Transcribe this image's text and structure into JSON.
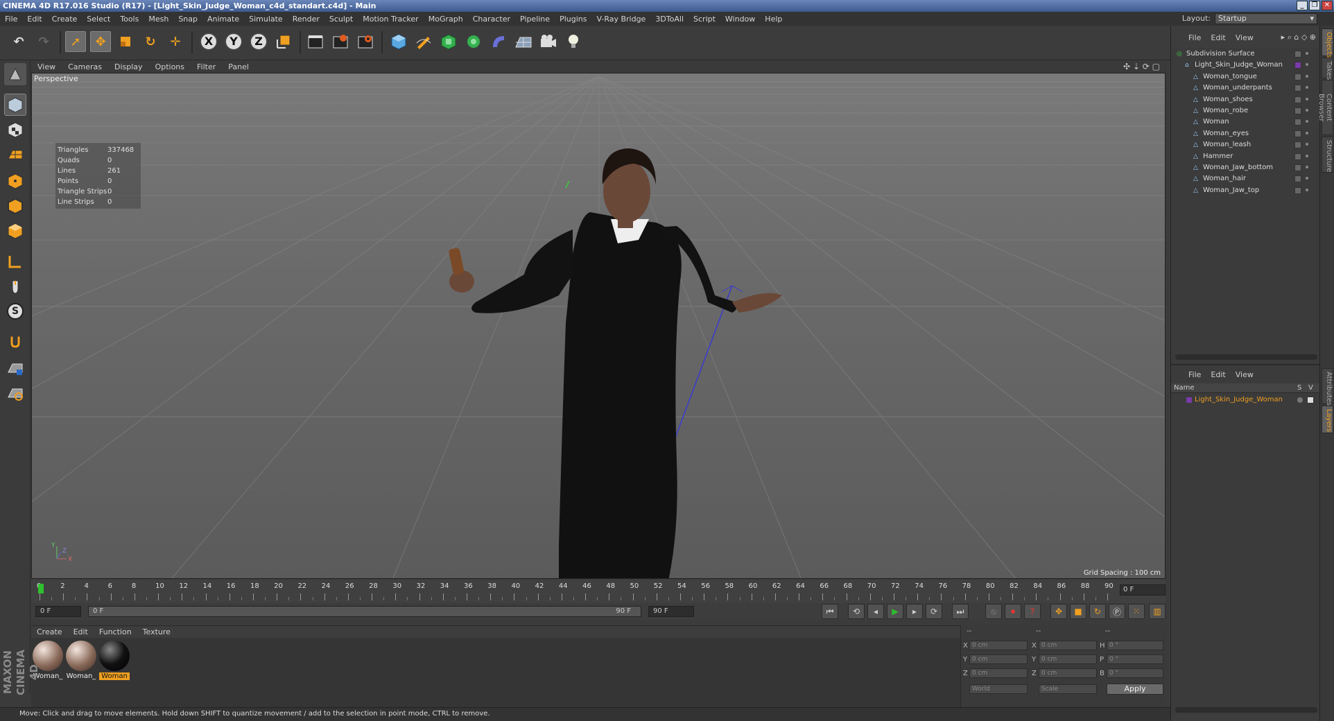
{
  "window": {
    "title": "CINEMA 4D R17.016 Studio (R17) - [Light_Skin_Judge_Woman_c4d_standart.c4d] - Main",
    "controls": [
      "_",
      "❐",
      "✕"
    ]
  },
  "menubar": {
    "items": [
      "File",
      "Edit",
      "Create",
      "Select",
      "Tools",
      "Mesh",
      "Snap",
      "Animate",
      "Simulate",
      "Render",
      "Sculpt",
      "Motion Tracker",
      "MoGraph",
      "Character",
      "Pipeline",
      "Plugins",
      "V-Ray Bridge",
      "3DToAll",
      "Script",
      "Window",
      "Help"
    ],
    "layout_label": "Layout:",
    "layout_value": "Startup"
  },
  "toolbar": {
    "icons": [
      "undo-icon",
      "redo-icon",
      "select-pointer-icon",
      "move-icon",
      "scale-icon",
      "rotate-icon",
      "live-select-icon",
      "x-axis-lock-icon",
      "y-axis-lock-icon",
      "z-axis-lock-icon",
      "coordinate-system-icon",
      "render-view-icon",
      "render-picture-viewer-icon",
      "render-settings-icon",
      "cube-primitive-icon",
      "pen-spline-icon",
      "subdivision-generator-icon",
      "array-cloner-icon",
      "deformer-icon",
      "floor-scene-icon",
      "camera-icon",
      "light-icon"
    ],
    "axis_labels": [
      "X",
      "Y",
      "Z"
    ]
  },
  "viewport": {
    "menu": [
      "View",
      "Cameras",
      "Display",
      "Options",
      "Filter",
      "Panel"
    ],
    "label": "Perspective",
    "stats": [
      {
        "key": "Triangles",
        "value": "337468"
      },
      {
        "key": "Quads",
        "value": "0"
      },
      {
        "key": "Lines",
        "value": "261"
      },
      {
        "key": "Points",
        "value": "0"
      },
      {
        "key": "Triangle Strips",
        "value": "0"
      },
      {
        "key": "Line Strips",
        "value": "0"
      }
    ],
    "grid_spacing": "Grid Spacing : 100 cm",
    "axes": [
      "Y",
      "Z",
      "X"
    ]
  },
  "timeline": {
    "ticks": [
      "0",
      "2",
      "4",
      "6",
      "8",
      "10",
      "12",
      "14",
      "16",
      "18",
      "20",
      "22",
      "24",
      "26",
      "28",
      "30",
      "32",
      "34",
      "36",
      "38",
      "40",
      "42",
      "44",
      "46",
      "48",
      "50",
      "52",
      "54",
      "56",
      "58",
      "60",
      "62",
      "64",
      "66",
      "68",
      "70",
      "72",
      "74",
      "76",
      "78",
      "80",
      "82",
      "84",
      "86",
      "88",
      "90"
    ],
    "current_frame": "0 F",
    "start_field": "0 F",
    "range_start": "0 F",
    "range_end": "90 F",
    "end_field": "90 F"
  },
  "materials": {
    "menu": [
      "Create",
      "Edit",
      "Function",
      "Texture"
    ],
    "items": [
      {
        "name": "Woman_",
        "selected": false
      },
      {
        "name": "Woman_",
        "selected": false
      },
      {
        "name": "Woman",
        "selected": true
      }
    ],
    "brand": [
      "MAXON",
      "CINEMA 4D"
    ]
  },
  "coordinates": {
    "headers": [
      "--",
      "--",
      "--"
    ],
    "rows": [
      {
        "a": "X",
        "av": "0 cm",
        "b": "X",
        "bv": "0 cm",
        "c": "H",
        "cv": "0 °"
      },
      {
        "a": "Y",
        "av": "0 cm",
        "b": "Y",
        "bv": "0 cm",
        "c": "P",
        "cv": "0 °"
      },
      {
        "a": "Z",
        "av": "0 cm",
        "b": "Z",
        "bv": "0 cm",
        "c": "B",
        "cv": "0 °"
      }
    ],
    "mode": "World",
    "scale": "Scale",
    "apply": "Apply"
  },
  "status": "Move: Click and drag to move elements. Hold down SHIFT to quantize movement / add to the selection in point mode, CTRL to remove.",
  "objects": {
    "menu": [
      "File",
      "Edit",
      "View"
    ],
    "tree": [
      {
        "label": "Subdivision Surface",
        "depth": 0,
        "icon": "subdivision-icon"
      },
      {
        "label": "Light_Skin_Judge_Woman",
        "depth": 1,
        "icon": "null-icon"
      },
      {
        "label": "Woman_tongue",
        "depth": 2,
        "icon": "polygon-object-icon"
      },
      {
        "label": "Woman_underpants",
        "depth": 2,
        "icon": "polygon-object-icon"
      },
      {
        "label": "Woman_shoes",
        "depth": 2,
        "icon": "polygon-object-icon"
      },
      {
        "label": "Woman_robe",
        "depth": 2,
        "icon": "polygon-object-icon"
      },
      {
        "label": "Woman",
        "depth": 2,
        "icon": "polygon-object-icon"
      },
      {
        "label": "Woman_eyes",
        "depth": 2,
        "icon": "polygon-object-icon"
      },
      {
        "label": "Woman_leash",
        "depth": 2,
        "icon": "polygon-object-icon"
      },
      {
        "label": "Hammer",
        "depth": 2,
        "icon": "polygon-object-icon"
      },
      {
        "label": "Woman_Jaw_bottom",
        "depth": 2,
        "icon": "polygon-object-icon"
      },
      {
        "label": "Woman_hair",
        "depth": 2,
        "icon": "polygon-object-icon"
      },
      {
        "label": "Woman_Jaw_top",
        "depth": 2,
        "icon": "polygon-object-icon"
      }
    ]
  },
  "layers": {
    "menu": [
      "File",
      "Edit",
      "View"
    ],
    "header": {
      "name": "Name",
      "s": "S",
      "v": "V"
    },
    "items": [
      "Light_Skin_Judge_Woman"
    ]
  },
  "side_tabs": [
    "Objects",
    "Takes",
    "Content Browser",
    "Structure",
    "Attributes",
    "Layers"
  ],
  "colors": {
    "accent": "#f0a020",
    "selected": "#e8a33a",
    "layer_color": "#7a3aa8"
  }
}
